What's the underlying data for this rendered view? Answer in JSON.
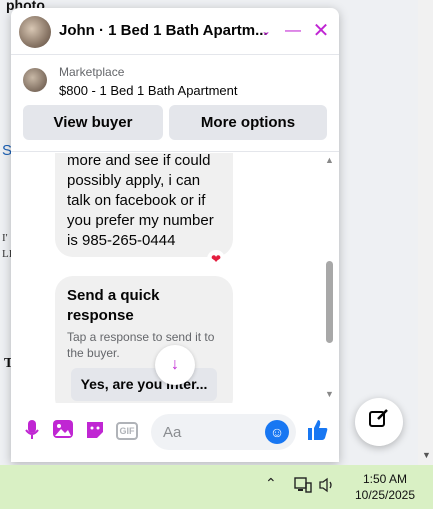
{
  "background": {
    "top_fragment": "photo",
    "frag_s": "S",
    "frag_i": "I'",
    "frag_li": "LI",
    "frag_t": "T"
  },
  "chat": {
    "title": "John · 1 Bed 1 Bath Apartm...",
    "icons": {
      "chevron": "chevron-down-icon",
      "minimize": "minimize-icon",
      "close": "close-icon"
    },
    "listing": {
      "source": "Marketplace",
      "title": "$800 - 1 Bed 1 Bath Apartment",
      "view_buyer": "View buyer",
      "more_options": "More options"
    },
    "messages": {
      "message1": "more and see if could possibly apply, i can talk on facebook or if you prefer my number is 985-265-0444",
      "reaction": "❤",
      "quick_response_title": "Send a quick response",
      "quick_response_sub": "Tap a response to send it to the buyer.",
      "quick_reply": "Yes, are you inter..."
    },
    "composer": {
      "placeholder": "Aa",
      "gif": "GIF"
    }
  },
  "taskbar": {
    "time": "1:50 AM",
    "date": "10/25/2025"
  },
  "colors": {
    "accent": "#c026d3",
    "like": "#1877f2",
    "taskbar": "#d9f0c4"
  }
}
